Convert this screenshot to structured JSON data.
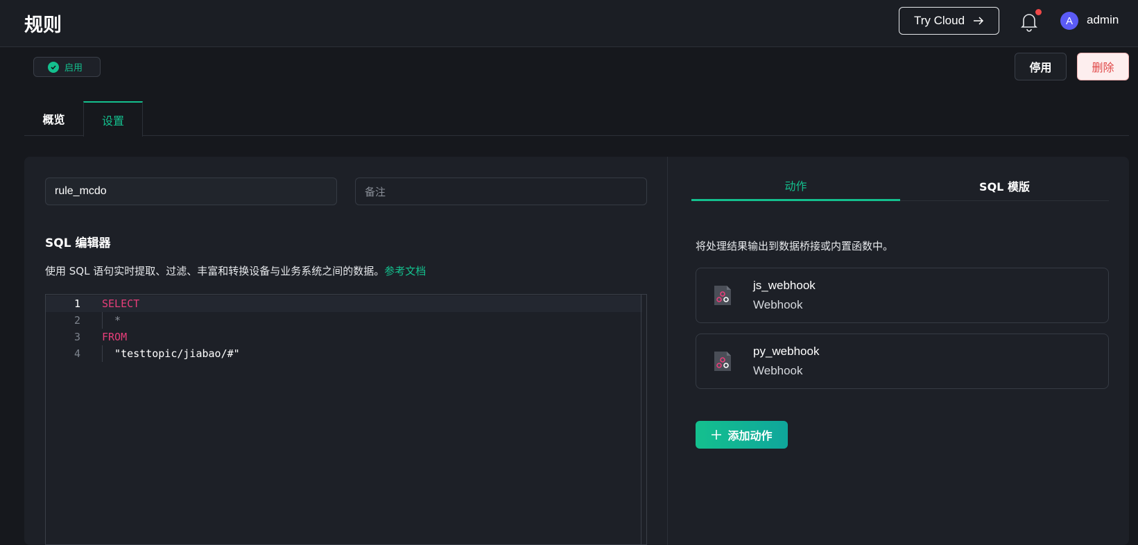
{
  "header": {
    "title": "规则",
    "try_cloud_label": "Try Cloud",
    "username": "admin",
    "avatar_letter": "A"
  },
  "rule": {
    "status": "启用",
    "disable_label": "停用",
    "delete_label": "删除"
  },
  "tabs": [
    {
      "label": "概览",
      "active": false
    },
    {
      "label": "设置",
      "active": true
    }
  ],
  "form": {
    "name_value": "rule_mcdo",
    "remark_placeholder": "备注"
  },
  "sql_editor": {
    "title": "SQL 编辑器",
    "description": "使用 SQL 语句实时提取、过滤、丰富和转换设备与业务系统之间的数据。",
    "doc_link": "参考文档",
    "lines": [
      {
        "num": "1",
        "text": "SELECT"
      },
      {
        "num": "2",
        "text": "  *"
      },
      {
        "num": "3",
        "text": "FROM"
      },
      {
        "num": "4",
        "text": "  \"testtopic/jiabao/#\""
      }
    ]
  },
  "right_panel": {
    "tabs": [
      {
        "label": "动作",
        "active": true
      },
      {
        "label": "SQL 模版",
        "active": false
      }
    ],
    "description": "将处理结果输出到数据桥接或内置函数中。",
    "actions": [
      {
        "name": "js_webhook",
        "type": "Webhook"
      },
      {
        "name": "py_webhook",
        "type": "Webhook"
      }
    ],
    "add_action_label": "添加动作"
  },
  "colors": {
    "accent": "#14c08e",
    "danger": "#e04848",
    "keyword": "#e83e7a"
  }
}
